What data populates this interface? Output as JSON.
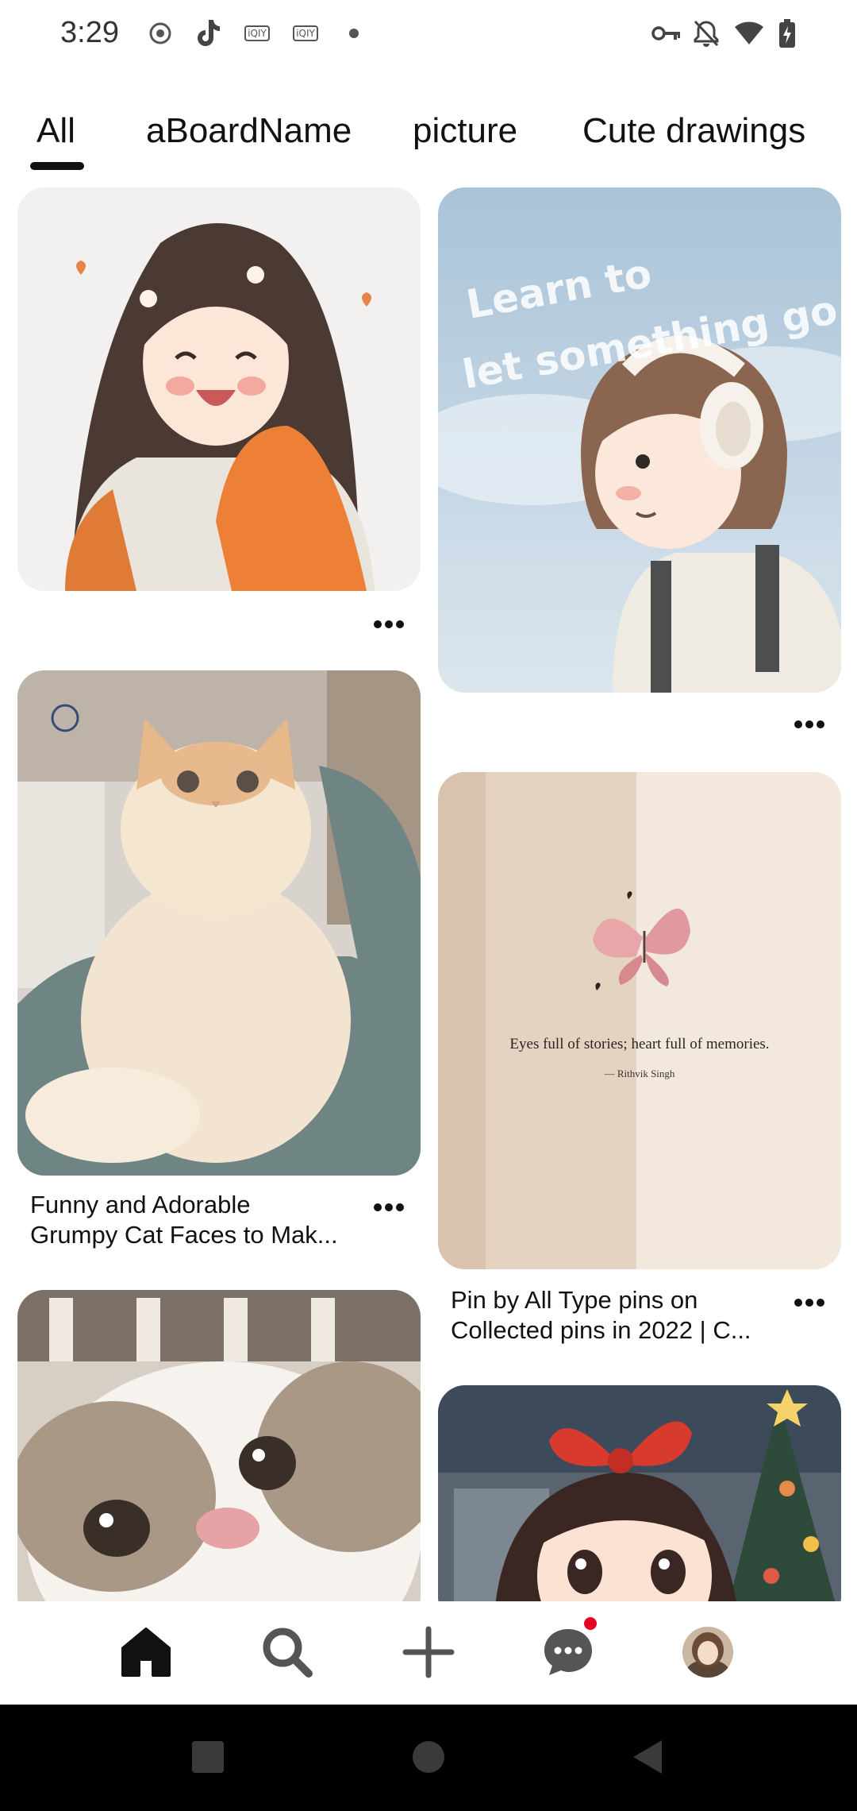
{
  "status_bar": {
    "time": "3:29",
    "left_icons": [
      "record-icon",
      "tiktok-icon",
      "iqiyi-icon",
      "iqiyi-icon",
      "dot-icon"
    ],
    "iqiyi_label": "iQIY",
    "right_icons": [
      "key-icon",
      "bell-off-icon",
      "wifi-icon",
      "battery-charging-icon"
    ]
  },
  "tabs": [
    {
      "label": "All",
      "selected": true
    },
    {
      "label": "aBoardName",
      "selected": false
    },
    {
      "label": "picture",
      "selected": false
    },
    {
      "label": "Cute drawings",
      "selected": false
    }
  ],
  "pins": [
    {
      "image": "anime-girl-orange-sweater",
      "title_lines": []
    },
    {
      "image": "anime-girl-headphones-sky",
      "overlay_text": [
        "Learn to",
        "let something go..."
      ],
      "title_lines": []
    },
    {
      "image": "fluffy-persian-cat",
      "title_lines": [
        "Funny and Adorable",
        "Grumpy Cat Faces to Mak..."
      ]
    },
    {
      "image": "butterfly-quote-page",
      "quote": "Eyes full of stories; heart full of memories.",
      "quote_author": "— Rithvik Singh",
      "title_lines": [
        "Pin by All Type pins on",
        "Collected pins in 2022 | C..."
      ]
    },
    {
      "image": "kitten-closeup",
      "title_lines": []
    },
    {
      "image": "anime-girl-red-bow-christmas",
      "title_lines": []
    }
  ],
  "bottom_nav": {
    "items": [
      "home-icon",
      "search-icon",
      "create-icon",
      "messages-icon",
      "profile-avatar"
    ],
    "has_message_notification": true
  },
  "colors": {
    "accent": "#e60023",
    "text": "#111111",
    "system_nav": "#000000"
  }
}
